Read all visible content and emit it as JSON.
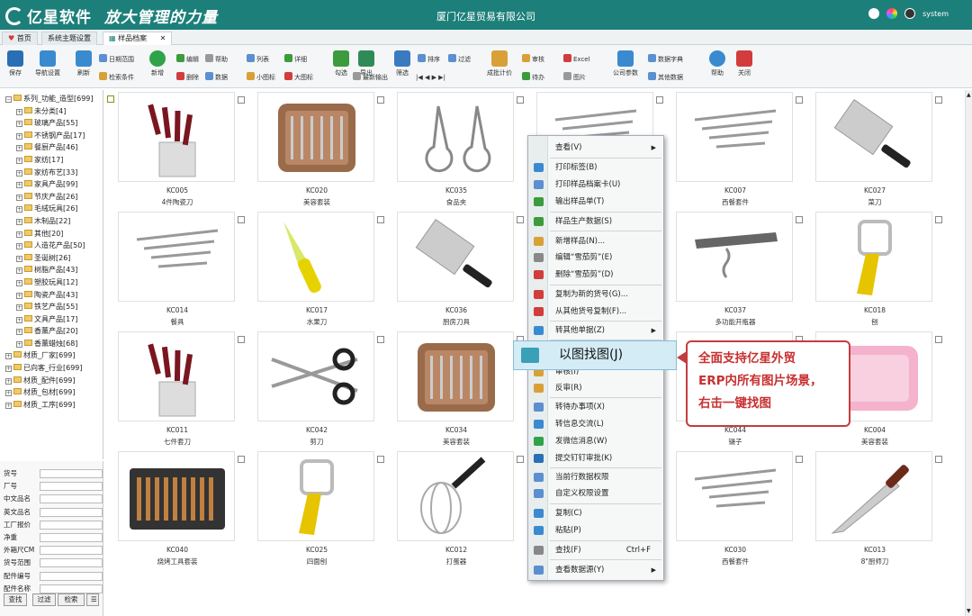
{
  "app": {
    "logo": "亿星软件",
    "slogan": "放大管理的力量",
    "company": "厦门亿星贸易有限公司",
    "user": "system"
  },
  "tabs": [
    {
      "label": "首页"
    },
    {
      "label": "系统主题设置"
    },
    {
      "label": "样品档案"
    }
  ],
  "toolbar": {
    "big": [
      "保存",
      "导航设置",
      "刷新",
      "新增",
      "勾选",
      "导出",
      "筛选",
      "成批计价",
      "公司参数",
      "帮助",
      "关闭"
    ],
    "small": [
      "日期范围",
      "检索条件",
      "编辑",
      "删除",
      "帮助",
      "数据",
      "列表",
      "小图标",
      "详细",
      "大图标",
      "最新输出",
      "排序",
      "过滤",
      "审核",
      "待办",
      "Excel",
      "图片",
      "数据字典",
      "其他数据"
    ]
  },
  "tree": [
    {
      "label": "系列_功能_造型[699]",
      "level": 0,
      "open": true
    },
    {
      "label": "未分类[4]",
      "level": 1
    },
    {
      "label": "玻璃产品[55]",
      "level": 1
    },
    {
      "label": "不锈钢产品[17]",
      "level": 1
    },
    {
      "label": "餐厨产品[46]",
      "level": 1
    },
    {
      "label": "家纺[17]",
      "level": 1
    },
    {
      "label": "家纺布艺[33]",
      "level": 1
    },
    {
      "label": "家具产品[99]",
      "level": 1
    },
    {
      "label": "节庆产品[26]",
      "level": 1
    },
    {
      "label": "毛绒玩具[26]",
      "level": 1
    },
    {
      "label": "木制品[22]",
      "level": 1
    },
    {
      "label": "其他[20]",
      "level": 1
    },
    {
      "label": "人造花产品[50]",
      "level": 1
    },
    {
      "label": "圣诞树[26]",
      "level": 1
    },
    {
      "label": "树脂产品[43]",
      "level": 1
    },
    {
      "label": "塑胶玩具[12]",
      "level": 1
    },
    {
      "label": "陶瓷产品[43]",
      "level": 1
    },
    {
      "label": "铁艺产品[55]",
      "level": 1
    },
    {
      "label": "文具产品[17]",
      "level": 1
    },
    {
      "label": "香薰产品[20]",
      "level": 1
    },
    {
      "label": "香薰蜡烛[68]",
      "level": 1
    },
    {
      "label": "材质_厂家[699]",
      "level": 0
    },
    {
      "label": "已向客_行业[699]",
      "level": 0
    },
    {
      "label": "材质_配件[699]",
      "level": 0
    },
    {
      "label": "材质_包材[699]",
      "level": 0
    },
    {
      "label": "材质_工序[699]",
      "level": 0
    }
  ],
  "filter": {
    "fields": [
      "货号",
      "厂号",
      "中文品名",
      "英文品名",
      "工厂报价",
      "净重",
      "外箱尺CM",
      "货号范围",
      "配件编号",
      "配件名称"
    ],
    "buttons": [
      "查找",
      "过滤",
      "检索"
    ]
  },
  "products": [
    {
      "code": "KC005",
      "name": "4件陶瓷刀",
      "icon": "knife-block-icon"
    },
    {
      "code": "KC020",
      "name": "美容套装",
      "icon": "manicure-set-icon"
    },
    {
      "code": "KC035",
      "name": "食品夹",
      "icon": "tongs-icon"
    },
    {
      "code": "",
      "name": "",
      "icon": "cutlery-icon"
    },
    {
      "code": "KC007",
      "name": "西餐套件",
      "icon": "cutlery-icon"
    },
    {
      "code": "KC027",
      "name": "菜刀",
      "icon": "cleaver-icon"
    },
    {
      "code": "KC014",
      "name": "餐具",
      "icon": "cutlery-icon"
    },
    {
      "code": "KC017",
      "name": "水果刀",
      "icon": "fruit-knife-icon"
    },
    {
      "code": "KC036",
      "name": "厨房刀具",
      "icon": "cleaver-icon"
    },
    {
      "code": "",
      "name": "",
      "icon": "cutlery-icon"
    },
    {
      "code": "KC037",
      "name": "多功能开瓶器",
      "icon": "corkscrew-icon"
    },
    {
      "code": "KC018",
      "name": "刨",
      "icon": "peeler-icon"
    },
    {
      "code": "KC011",
      "name": "七件套刀",
      "icon": "knife-block-icon"
    },
    {
      "code": "KC042",
      "name": "剪刀",
      "icon": "scissors-icon"
    },
    {
      "code": "KC034",
      "name": "美容套装",
      "icon": "manicure-set-icon"
    },
    {
      "code": "",
      "name": "",
      "icon": "cutlery-icon"
    },
    {
      "code": "KC044",
      "name": "镊子",
      "icon": "tweezers-icon"
    },
    {
      "code": "KC004",
      "name": "美容套装",
      "icon": "pink-case-icon"
    },
    {
      "code": "KC040",
      "name": "烧烤工具套装",
      "icon": "bbq-case-icon"
    },
    {
      "code": "KC025",
      "name": "四面刨",
      "icon": "peeler-icon"
    },
    {
      "code": "KC012",
      "name": "打蛋器",
      "icon": "whisk-icon"
    },
    {
      "code": "",
      "name": "",
      "icon": "cutlery-icon"
    },
    {
      "code": "KC030",
      "name": "西餐套件",
      "icon": "cutlery-icon"
    },
    {
      "code": "KC013",
      "name": "8\"厨师刀",
      "icon": "chef-knife-icon"
    }
  ],
  "context_menu": [
    {
      "label": "查看(V)",
      "arrow": true
    },
    {
      "label": "打印标签(B)"
    },
    {
      "label": "打印样品档案卡(U)"
    },
    {
      "label": "输出样品单(T)"
    },
    {
      "label": "样品生产数据(S)"
    },
    {
      "label": "新增样品(N)..."
    },
    {
      "label": "编辑“雪茄剪”(E)"
    },
    {
      "label": "删除“雪茄剪”(D)"
    },
    {
      "label": "复制为新的货号(G)..."
    },
    {
      "label": "从其他货号复制(F)..."
    },
    {
      "label": "转其他单据(Z)",
      "arrow": true
    },
    {
      "label": "以图找图(J)"
    },
    {
      "label": "审核(I)"
    },
    {
      "label": "反审(R)"
    },
    {
      "label": "转待办事项(X)"
    },
    {
      "label": "转信息交流(L)"
    },
    {
      "label": "发微信消息(W)"
    },
    {
      "label": "提交钉钉审批(K)"
    },
    {
      "label": "当前行数据权限"
    },
    {
      "label": "自定义权限设置"
    },
    {
      "label": "复制(C)"
    },
    {
      "label": "粘贴(P)"
    },
    {
      "label": "查找(F)",
      "shortcut": "Ctrl+F"
    },
    {
      "label": "查看数据源(Y)",
      "arrow": true
    }
  ],
  "highlight": "以图找图(J)",
  "callout": {
    "line1": "全面支持亿星外贸",
    "line2": "ERP内所有图片场景，",
    "line3": "右击一键找图"
  },
  "colors": {
    "title_bar": "#1d7f7a",
    "callout": "#c82f2f",
    "highlight": "#d4ecf5"
  }
}
